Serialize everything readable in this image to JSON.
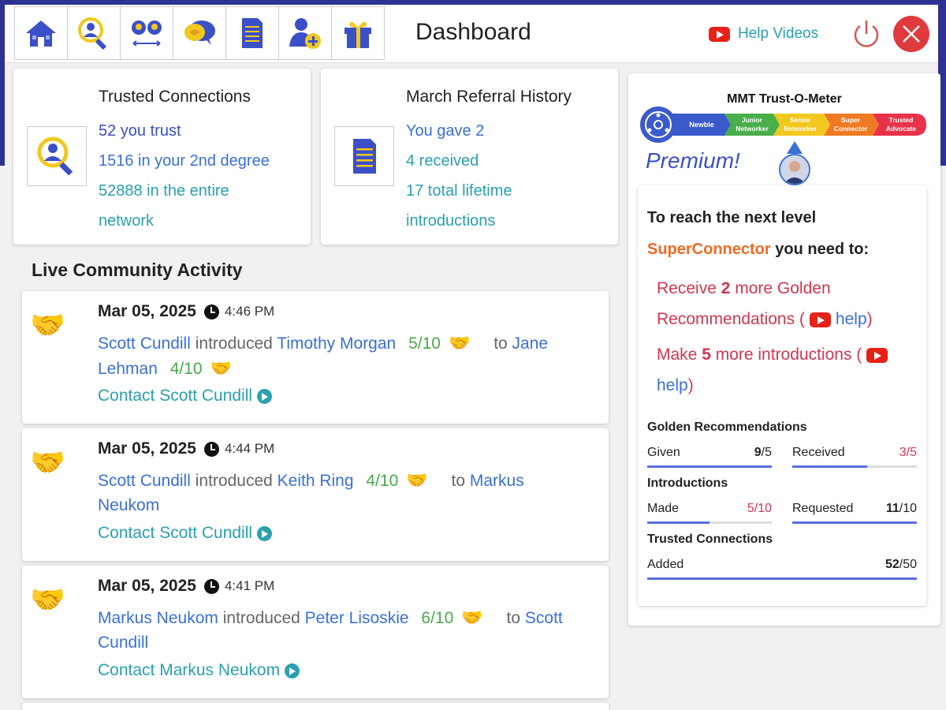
{
  "header": {
    "title": "Dashboard",
    "help_videos": "Help Videos",
    "toolbar": [
      "home-icon",
      "search-person-icon",
      "people-exchange-icon",
      "handshake-chat-icon",
      "document-icon",
      "add-user-icon",
      "gift-icon"
    ]
  },
  "trusted": {
    "title": "Trusted Connections",
    "line1": "52 you trust",
    "line2": "1516 in your 2nd degree",
    "line3": "52888 in the entire",
    "line4": "network"
  },
  "referral": {
    "title": "March Referral History",
    "line1": "You gave 2",
    "line2": "4 received",
    "line3": "17 total lifetime",
    "line4": "introductions"
  },
  "activity": {
    "title": "Live Community Activity",
    "items": [
      {
        "date": "Mar 05, 2025",
        "time": "4:46 PM",
        "from": "Scott Cundill",
        "verb": "introduced",
        "person": "Timothy Morgan",
        "person_score": "5/10",
        "to_word": "to",
        "target": "Jane Lehman",
        "target_score": "4/10",
        "contact": "Contact Scott Cundill"
      },
      {
        "date": "Mar 05, 2025",
        "time": "4:44 PM",
        "from": "Scott Cundill",
        "verb": "introduced",
        "person": "Keith Ring",
        "person_score": "4/10",
        "to_word": "to",
        "target": "Markus Neukom",
        "target_score": "",
        "contact": "Contact Scott Cundill"
      },
      {
        "date": "Mar 05, 2025",
        "time": "4:41 PM",
        "from": "Markus Neukom",
        "verb": "introduced",
        "person": "Peter Lisoskie",
        "person_score": "6/10",
        "to_word": "to",
        "target": "Scott Cundill",
        "target_score": "",
        "contact": "Contact Markus Neukom"
      }
    ]
  },
  "meter": {
    "title": "MMT Trust-O-Meter",
    "levels": [
      {
        "name": "Newbie",
        "color": "#3b5bcc"
      },
      {
        "name": "Junior Networker",
        "color": "#4aae4a"
      },
      {
        "name": "Senior Networker",
        "color": "#f2c81f"
      },
      {
        "name": "Super Connector",
        "color": "#f07a24"
      },
      {
        "name": "Trusted Advocate",
        "color": "#e8324a"
      }
    ],
    "current_level": "Senior Networker",
    "premium": "Premium!"
  },
  "next_level": {
    "line1": "To reach the next level",
    "level_name": "SuperConnector",
    "line2_rest": " you need to:",
    "req1_a": "Receive ",
    "req1_num": "2",
    "req1_b": " more Golden Recommendations (",
    "req1_help": "help",
    "req1_end": ")",
    "req2_a": "Make ",
    "req2_num": "5",
    "req2_b": " more introductions (",
    "req2_help": "help",
    "req2_end": ")"
  },
  "metrics": {
    "golden_title": "Golden Recommendations",
    "given_label": "Given",
    "given_num": "9",
    "given_den": "/5",
    "given_fraction": 1.0,
    "received_label": "Received",
    "received_value": "3/5",
    "received_fraction": 0.6,
    "intro_title": "Introductions",
    "made_label": "Made",
    "made_value": "5/10",
    "made_fraction": 0.5,
    "requested_label": "Requested",
    "requested_num": "11",
    "requested_den": "/10",
    "requested_fraction": 1.0,
    "tc_title": "Trusted Connections",
    "added_label": "Added",
    "added_num": "52",
    "added_den": "/50",
    "added_fraction": 1.0
  }
}
